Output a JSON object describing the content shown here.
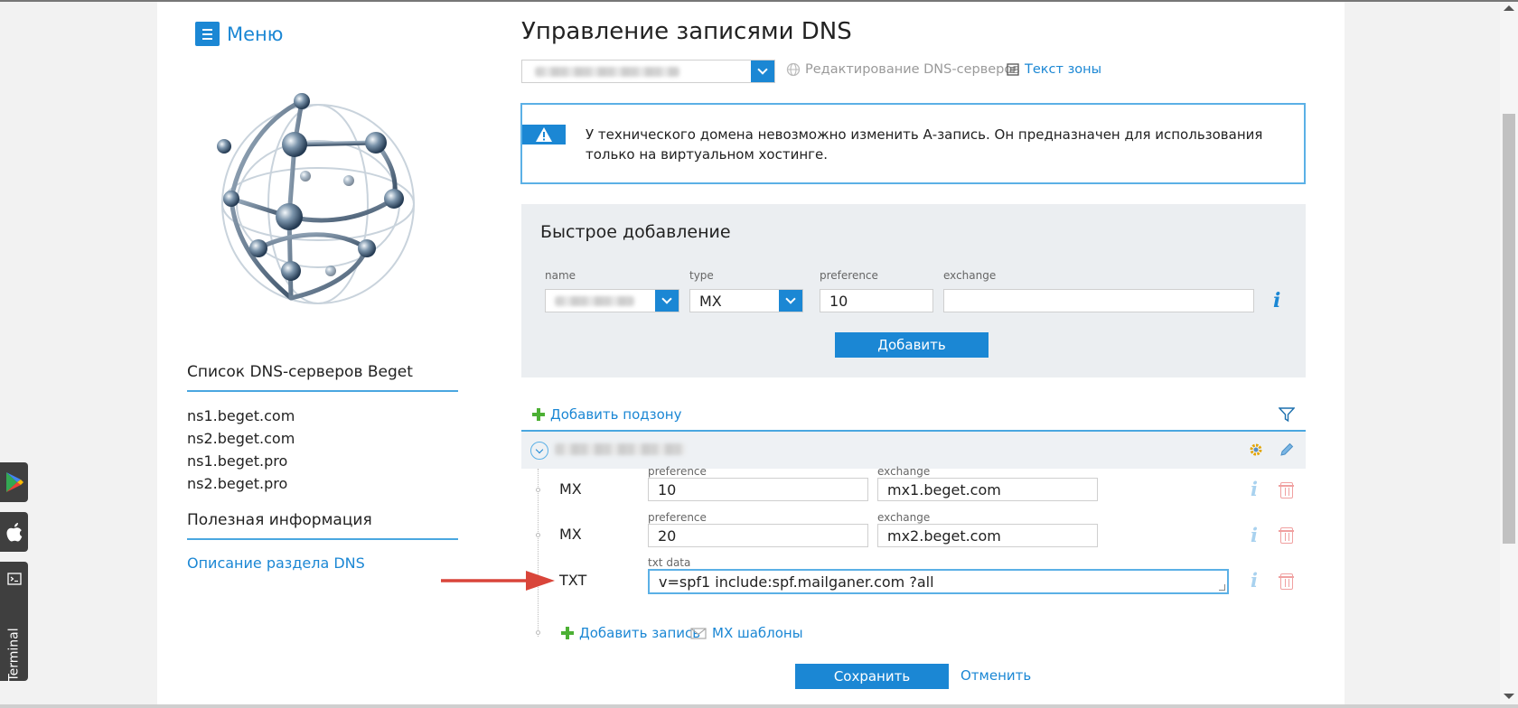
{
  "menu": {
    "label": "Меню"
  },
  "page_title": "Управление записями DNS",
  "toolbar": {
    "dns_servers_edit": "Редактирование DNS-серверов",
    "zone_text": "Текст зоны"
  },
  "alert": {
    "text": "У технического домена невозможно изменить А-запись. Он предназначен для использования только на виртуальном хостинге."
  },
  "quick_add": {
    "title": "Быстрое добавление",
    "labels": {
      "name": "name",
      "type": "type",
      "preference": "preference",
      "exchange": "exchange"
    },
    "type_value": "MX",
    "preference_value": "10",
    "exchange_value": "",
    "add_button": "Добавить"
  },
  "sidebar": {
    "dns_list_title": "Список DNS-серверов Beget",
    "dns_servers": [
      "ns1.beget.com",
      "ns2.beget.com",
      "ns1.beget.pro",
      "ns2.beget.pro"
    ],
    "useful_title": "Полезная информация",
    "description_link": "Описание раздела DNS"
  },
  "records": {
    "add_subzone": "Добавить подзону",
    "items": [
      {
        "type": "MX",
        "label1": "preference",
        "value1": "10",
        "label2": "exchange",
        "value2": "mx1.beget.com"
      },
      {
        "type": "MX",
        "label1": "preference",
        "value1": "20",
        "label2": "exchange",
        "value2": "mx2.beget.com"
      },
      {
        "type": "TXT",
        "label1": "txt data",
        "value1": "v=spf1 include:spf.mailganer.com ?all"
      }
    ],
    "add_record": "Добавить запись",
    "mx_templates": "MX шаблоны"
  },
  "actions": {
    "save": "Сохранить",
    "cancel": "Отменить"
  },
  "side_tabs": {
    "terminal": "Terminal"
  },
  "colors": {
    "accent": "#1b87d4",
    "add_green": "#4cb034",
    "delete_red": "#f0a0a0",
    "arrow_red": "#d9453a"
  }
}
